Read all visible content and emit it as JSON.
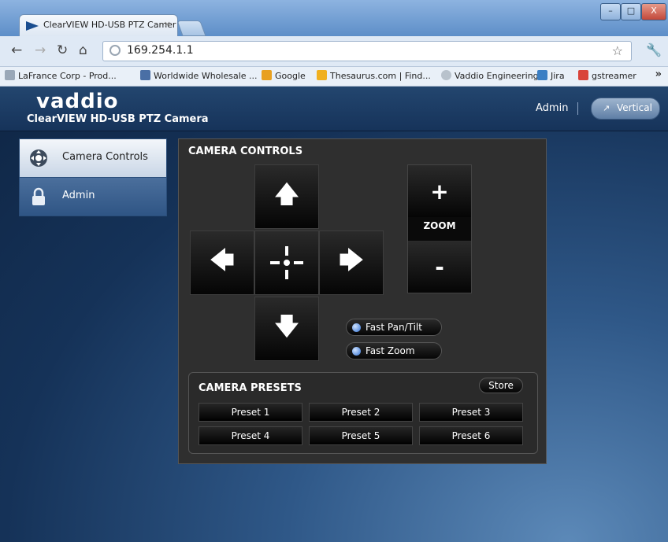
{
  "browser": {
    "tab_title": "ClearVIEW HD-USB PTZ Camer",
    "tab_close": "×",
    "window_controls": [
      "–",
      "□",
      "X"
    ],
    "url": "169.254.1.1",
    "bookmarks": [
      {
        "label": "LaFrance Corp - Prod...",
        "icon": "page-icon",
        "color": "#9aa8b8"
      },
      {
        "label": "Worldwide Wholesale ...",
        "icon": "monitor-icon",
        "color": "#4a6fa5"
      },
      {
        "label": "Google",
        "icon": "google-icon",
        "color": "#e8a020"
      },
      {
        "label": "Thesaurus.com | Find...",
        "icon": "thesaurus-icon",
        "color": "#f0b020"
      },
      {
        "label": "Vaddio Engineering",
        "icon": "globe-icon",
        "color": "#b8c2cc"
      },
      {
        "label": "Jira",
        "icon": "jira-icon",
        "color": "#3b7fc4"
      },
      {
        "label": "gstreamer",
        "icon": "gstreamer-icon",
        "color": "#d9443a"
      }
    ],
    "bookmarks_more": "»"
  },
  "header": {
    "logo": "vaddio",
    "subtitle": "ClearVIEW HD-USB PTZ Camera",
    "admin_link": "Admin",
    "vertical_button": "Vertical"
  },
  "sidebar": {
    "items": [
      {
        "label": "Camera Controls",
        "active": true,
        "icon": "camera-controls-icon"
      },
      {
        "label": "Admin",
        "active": false,
        "icon": "lock-icon"
      }
    ]
  },
  "camera_controls": {
    "title": "CAMERA CONTROLS",
    "up": "🡅",
    "down": "🡇",
    "left": "🡄",
    "right": "🡆",
    "zoom_in": "+",
    "zoom_label": "ZOOM",
    "zoom_out": "-",
    "fast_pan_tilt": "Fast Pan/Tilt",
    "fast_zoom": "Fast Zoom"
  },
  "presets": {
    "title": "CAMERA PRESETS",
    "store": "Store",
    "items": [
      "Preset 1",
      "Preset 2",
      "Preset 3",
      "Preset 4",
      "Preset 5",
      "Preset 6"
    ]
  },
  "colors": {
    "accent_blue": "#2f6fd1",
    "panel_bg": "#2f2f2f",
    "header_bg": "#16335a"
  }
}
